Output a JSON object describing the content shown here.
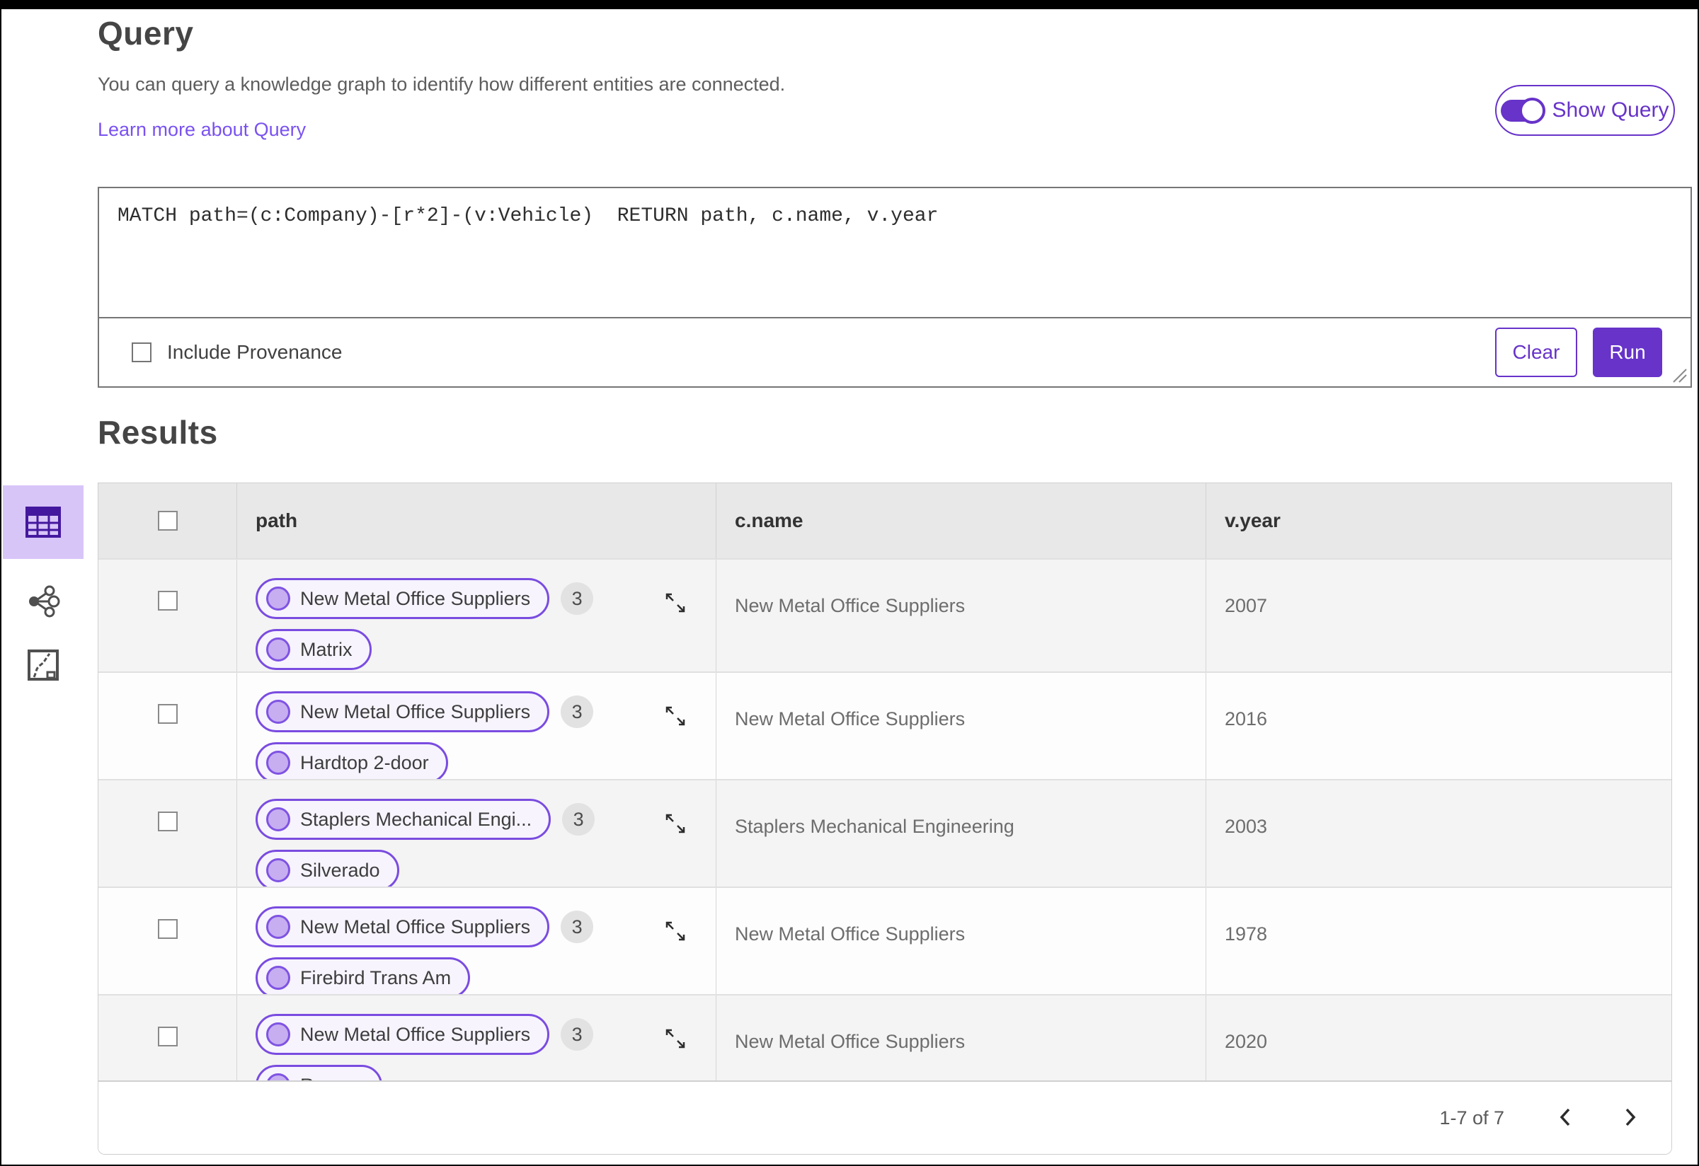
{
  "colors": {
    "accent": "#6733c9",
    "link": "#7a52f0",
    "tile": "#d8c5f8",
    "chip_border": "#7a4ce0",
    "node_fill": "#c7aef1",
    "header_bg": "#e8e8e8",
    "row_alt_bg": "#f4f4f4"
  },
  "query_section": {
    "title": "Query",
    "description": "You can query a knowledge graph to identify how different entities are connected.",
    "learn_more_label": "Learn more about Query",
    "show_query_label": "Show Query",
    "show_query_on": true,
    "query_text": "MATCH path=(c:Company)-[r*2]-(v:Vehicle)  RETURN path, c.name, v.year",
    "include_provenance_label": "Include Provenance",
    "include_provenance_checked": false,
    "clear_label": "Clear",
    "run_label": "Run"
  },
  "results_section": {
    "title": "Results",
    "views": {
      "table_view_icon": "table-view-icon",
      "graph_view_icon": "graph-view-icon",
      "map_view_icon": "map-view-icon",
      "selected": "table-view"
    },
    "table": {
      "columns": {
        "path": "path",
        "c_name": "c.name",
        "v_year": "v.year"
      },
      "rows": [
        {
          "path_start": "New Metal Office Suppliers",
          "path_badge": "3",
          "path_end": "Matrix",
          "c_name": "New Metal Office Suppliers",
          "v_year": "2007"
        },
        {
          "path_start": "New Metal Office Suppliers",
          "path_badge": "3",
          "path_end": "Hardtop 2-door",
          "c_name": "New Metal Office Suppliers",
          "v_year": "2016"
        },
        {
          "path_start": "Staplers Mechanical Engi...",
          "path_badge": "3",
          "path_end": "Silverado",
          "c_name": "Staplers Mechanical Engineering",
          "v_year": "2003"
        },
        {
          "path_start": "New Metal Office Suppliers",
          "path_badge": "3",
          "path_end": "Firebird Trans Am",
          "c_name": "New Metal Office Suppliers",
          "v_year": "1978"
        },
        {
          "path_start": "New Metal Office Suppliers",
          "path_badge": "3",
          "path_end": "Ranger",
          "c_name": "New Metal Office Suppliers",
          "v_year": "2020"
        }
      ],
      "pagination": {
        "range_label": "1-7 of 7"
      }
    }
  }
}
